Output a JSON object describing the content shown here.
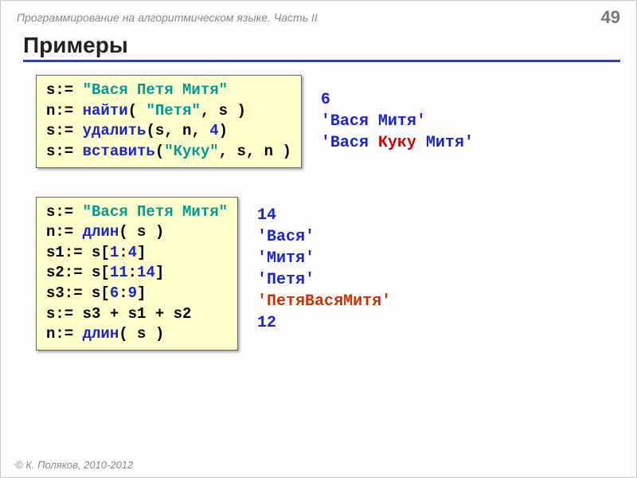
{
  "header": {
    "subtitle": "Программирование на алгоритмическом языке. Часть II",
    "page": "49"
  },
  "title": "Примеры",
  "footer": "© К. Поляков, 2010-2012",
  "code1": {
    "l1": {
      "a": "s:= ",
      "s": "\"Вася Петя Митя\""
    },
    "l2": {
      "a": "n:= ",
      "fn": "найти",
      "b": "( ",
      "s": "\"Петя\"",
      "c": ", s )"
    },
    "l3": {
      "a": "s:= ",
      "fn": "удалить",
      "b": "(s, n, ",
      "n": "4",
      "c": ")"
    },
    "l4": {
      "a": "s:= ",
      "fn": "вставить",
      "b": "(",
      "s": "\"Куку\"",
      "c": ", s, n )"
    }
  },
  "out1": {
    "l1": "6",
    "l2": "'Вася  Митя'",
    "l3a": "'Вася ",
    "l3b": "Куку",
    "l3c": " Митя'"
  },
  "code2": {
    "l1": {
      "a": "s:= ",
      "s": "\"Вася Петя Митя\""
    },
    "l2": {
      "a": "n:= ",
      "fn": "длин",
      "b": "( s )"
    },
    "l3": {
      "a": "s1:= s[",
      "n1": "1",
      "b": ":",
      "n2": "4",
      "c": "]"
    },
    "l4": {
      "a": "s2:= s[",
      "n1": "11",
      "b": ":",
      "n2": "14",
      "c": "]"
    },
    "l5": {
      "a": "s3:= s[",
      "n1": "6",
      "b": ":",
      "n2": "9",
      "c": "]"
    },
    "l6": {
      "a": "s:= s3 + s1 + s2"
    },
    "l7": {
      "a": "n:= ",
      "fn": "длин",
      "b": "( s )"
    }
  },
  "out2": {
    "l1": "14",
    "l2": "'Вася'",
    "l3": "'Митя'",
    "l4": "'Петя'",
    "l5": "'ПетяВасяМитя'",
    "l6": "12"
  }
}
